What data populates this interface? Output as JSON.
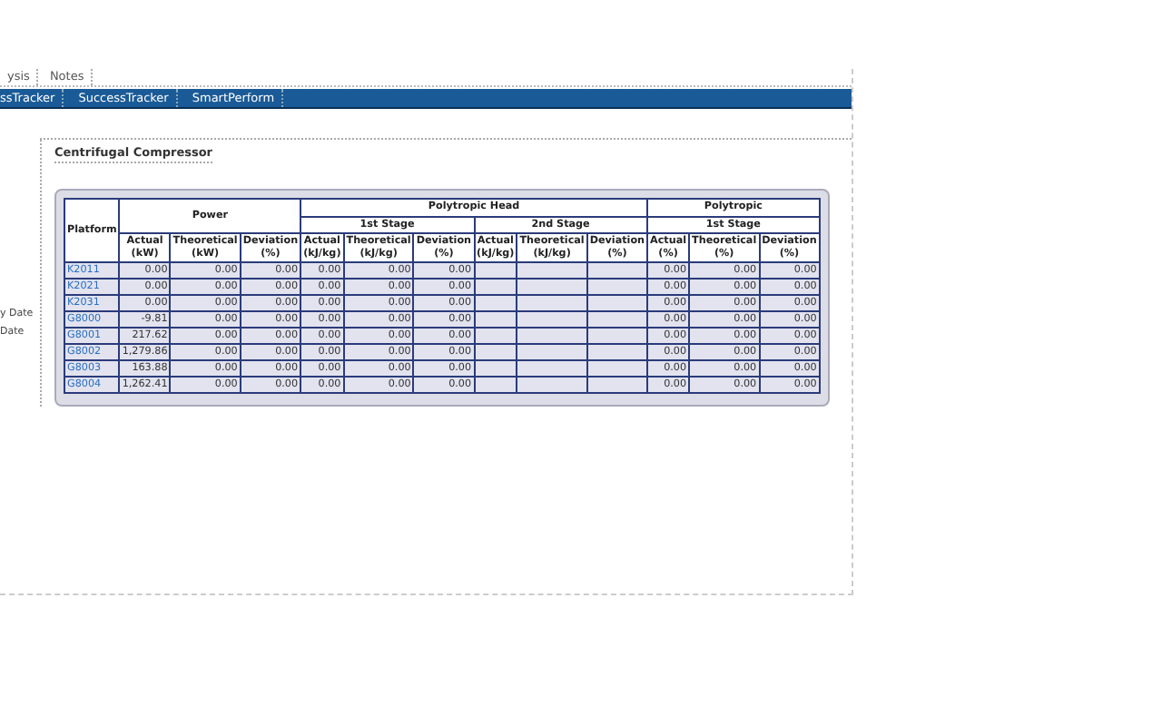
{
  "tabs": [
    {
      "label": "ysis",
      "selected": false
    },
    {
      "label": "Notes",
      "selected": false
    }
  ],
  "nav_links": [
    "ssTracker",
    "SuccessTracker",
    "SmartPerform"
  ],
  "side_labels": [
    "y Date",
    "Date"
  ],
  "panel": {
    "title": "Centrifugal Compressor"
  },
  "table": {
    "platform_heading": "Platform",
    "groups": [
      {
        "title": "Power",
        "stages": [
          {
            "columns": [
              [
                "Actual",
                "(kW)"
              ],
              [
                "Theoretical",
                "(kW)"
              ],
              [
                "Deviation",
                "(%)"
              ]
            ]
          }
        ]
      },
      {
        "title": "Polytropic Head",
        "stages": [
          {
            "title": "1st Stage",
            "columns": [
              [
                "Actual",
                "(kJ/kg)"
              ],
              [
                "Theoretical",
                "(kJ/kg)"
              ],
              [
                "Deviation",
                "(%)"
              ]
            ]
          },
          {
            "title": "2nd Stage",
            "columns": [
              [
                "Actual",
                "(kJ/kg)"
              ],
              [
                "Theoretical",
                "(kJ/kg)"
              ],
              [
                "Deviation",
                "(%)"
              ]
            ]
          }
        ]
      },
      {
        "title": "Polytropic",
        "stages": [
          {
            "title": "1st Stage",
            "columns": [
              [
                "Actual",
                "(%)"
              ],
              [
                "Theoretical",
                "(%)"
              ],
              [
                "Deviation",
                "(%)"
              ]
            ]
          }
        ]
      }
    ],
    "rows": [
      {
        "platform": "K2011",
        "power": [
          "0.00",
          "0.00",
          "0.00"
        ],
        "polytropic_head_1st_stage": [
          "0.00",
          "0.00",
          "0.00"
        ],
        "polytropic_1st_stage": [
          "0.00",
          "0.00",
          "0.00"
        ]
      },
      {
        "platform": "K2021",
        "power": [
          "0.00",
          "0.00",
          "0.00"
        ],
        "polytropic_head_1st_stage": [
          "0.00",
          "0.00",
          "0.00"
        ],
        "polytropic_1st_stage": [
          "0.00",
          "0.00",
          "0.00"
        ]
      },
      {
        "platform": "K2031",
        "power": [
          "0.00",
          "0.00",
          "0.00"
        ],
        "polytropic_head_1st_stage": [
          "0.00",
          "0.00",
          "0.00"
        ],
        "polytropic_1st_stage": [
          "0.00",
          "0.00",
          "0.00"
        ]
      },
      {
        "platform": "G8000",
        "power": [
          "-9.81",
          "0.00",
          "0.00"
        ],
        "polytropic_head_1st_stage": [
          "0.00",
          "0.00",
          "0.00"
        ],
        "polytropic_1st_stage": [
          "0.00",
          "0.00",
          "0.00"
        ]
      },
      {
        "platform": "G8001",
        "power": [
          "217.62",
          "0.00",
          "0.00"
        ],
        "polytropic_head_1st_stage": [
          "0.00",
          "0.00",
          "0.00"
        ],
        "polytropic_1st_stage": [
          "0.00",
          "0.00",
          "0.00"
        ]
      },
      {
        "platform": "G8002",
        "power": [
          "1,279.86",
          "0.00",
          "0.00"
        ],
        "polytropic_head_1st_stage": [
          "0.00",
          "0.00",
          "0.00"
        ],
        "polytropic_1st_stage": [
          "0.00",
          "0.00",
          "0.00"
        ]
      },
      {
        "platform": "G8003",
        "power": [
          "163.88",
          "0.00",
          "0.00"
        ],
        "polytropic_head_1st_stage": [
          "0.00",
          "0.00",
          "0.00"
        ],
        "polytropic_1st_stage": [
          "0.00",
          "0.00",
          "0.00"
        ]
      },
      {
        "platform": "G8004",
        "power": [
          "1,262.41",
          "0.00",
          "0.00"
        ],
        "polytropic_head_1st_stage": [
          "0.00",
          "0.00",
          "0.00"
        ],
        "polytropic_1st_stage": [
          "0.00",
          "0.00",
          "0.00"
        ]
      }
    ]
  }
}
